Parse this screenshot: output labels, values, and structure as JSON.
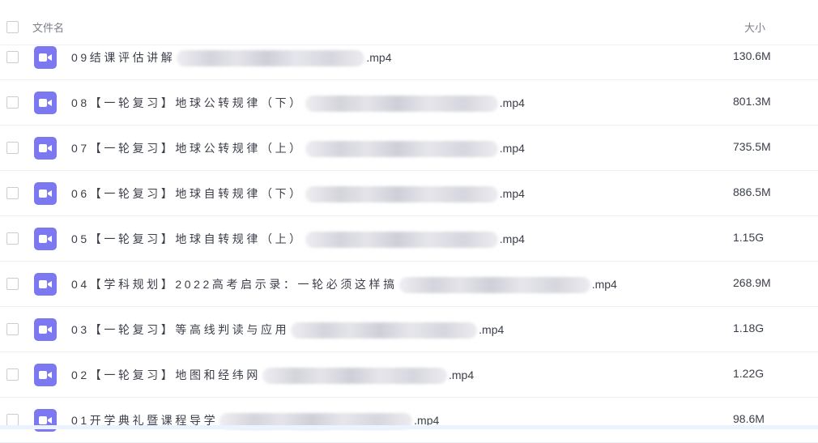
{
  "header": {
    "name_label": "文件名",
    "size_label": "大小"
  },
  "files": [
    {
      "name": "09结课评估讲解",
      "ext": ".mp4",
      "size": "130.6M"
    },
    {
      "name": "08【一轮复习】地球公转规律（下）",
      "ext": ".mp4",
      "size": "801.3M"
    },
    {
      "name": "07【一轮复习】地球公转规律（上）",
      "ext": ".mp4",
      "size": "735.5M"
    },
    {
      "name": "06【一轮复习】地球自转规律（下）",
      "ext": ".mp4",
      "size": "886.5M"
    },
    {
      "name": "05【一轮复习】地球自转规律（上）",
      "ext": ".mp4",
      "size": "1.15G"
    },
    {
      "name": "04【学科规划】2022高考启示录：一轮必须这样搞",
      "ext": ".mp4",
      "size": "268.9M"
    },
    {
      "name": "03【一轮复习】等高线判读与应用",
      "ext": ".mp4",
      "size": "1.18G"
    },
    {
      "name": "02【一轮复习】地图和经纬网",
      "ext": ".mp4",
      "size": "1.22G"
    },
    {
      "name": "01开学典礼暨课程导学",
      "ext": ".mp4",
      "size": "98.6M"
    }
  ],
  "icons": {
    "file_type": "video-file-icon"
  },
  "colors": {
    "icon_bg": "#7b78f0",
    "text": "#3b3f4a",
    "header_text": "#7a7f8a"
  }
}
